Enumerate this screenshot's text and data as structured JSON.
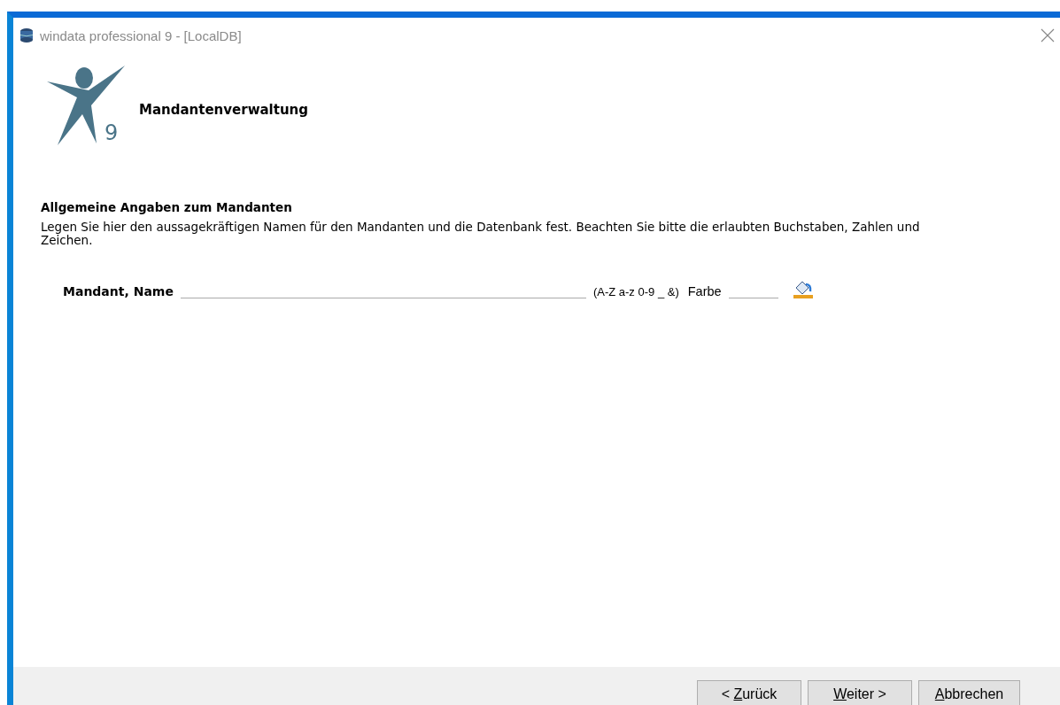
{
  "window": {
    "title": "windata professional 9 - [LocalDB]"
  },
  "header": {
    "logo_digit": "9",
    "title": "Mandantenverwaltung"
  },
  "section": {
    "heading": "Allgemeine Angaben zum Mandanten",
    "description": "Legen Sie hier den aussagekräftigen Namen für den Mandanten und die Datenbank fest. Beachten Sie bitte die erlaubten Buchstaben, Zahlen und Zeichen."
  },
  "form": {
    "name_label": "Mandant, Name",
    "hint": "(A-Z a-z 0-9 _ &)",
    "color_label": "Farbe"
  },
  "buttons": [
    {
      "before": "< ",
      "key": "Z",
      "after": "urück"
    },
    {
      "key": "W",
      "after": "eiter >"
    },
    {
      "key": "A",
      "after": "bbrechen"
    }
  ]
}
